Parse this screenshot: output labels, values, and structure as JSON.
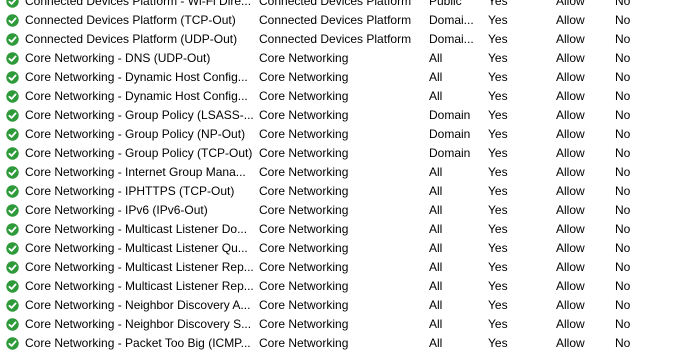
{
  "icons": {
    "enabled_rule": "check-circle-icon",
    "enabled_color": "#2e9a3a"
  },
  "rules": [
    {
      "name": "Connected Devices Platform - Wi-Fi Dire...",
      "group": "Connected Devices Platform",
      "profile": "Public",
      "enabled": "Yes",
      "action": "Allow",
      "override": "No"
    },
    {
      "name": "Connected Devices Platform (TCP-Out)",
      "group": "Connected Devices Platform",
      "profile": "Domai...",
      "enabled": "Yes",
      "action": "Allow",
      "override": "No"
    },
    {
      "name": "Connected Devices Platform (UDP-Out)",
      "group": "Connected Devices Platform",
      "profile": "Domai...",
      "enabled": "Yes",
      "action": "Allow",
      "override": "No"
    },
    {
      "name": "Core Networking - DNS (UDP-Out)",
      "group": "Core Networking",
      "profile": "All",
      "enabled": "Yes",
      "action": "Allow",
      "override": "No"
    },
    {
      "name": "Core Networking - Dynamic Host Config...",
      "group": "Core Networking",
      "profile": "All",
      "enabled": "Yes",
      "action": "Allow",
      "override": "No"
    },
    {
      "name": "Core Networking - Dynamic Host Config...",
      "group": "Core Networking",
      "profile": "All",
      "enabled": "Yes",
      "action": "Allow",
      "override": "No"
    },
    {
      "name": "Core Networking - Group Policy (LSASS-...",
      "group": "Core Networking",
      "profile": "Domain",
      "enabled": "Yes",
      "action": "Allow",
      "override": "No"
    },
    {
      "name": "Core Networking - Group Policy (NP-Out)",
      "group": "Core Networking",
      "profile": "Domain",
      "enabled": "Yes",
      "action": "Allow",
      "override": "No"
    },
    {
      "name": "Core Networking - Group Policy (TCP-Out)",
      "group": "Core Networking",
      "profile": "Domain",
      "enabled": "Yes",
      "action": "Allow",
      "override": "No"
    },
    {
      "name": "Core Networking - Internet Group Mana...",
      "group": "Core Networking",
      "profile": "All",
      "enabled": "Yes",
      "action": "Allow",
      "override": "No"
    },
    {
      "name": "Core Networking - IPHTTPS (TCP-Out)",
      "group": "Core Networking",
      "profile": "All",
      "enabled": "Yes",
      "action": "Allow",
      "override": "No"
    },
    {
      "name": "Core Networking - IPv6 (IPv6-Out)",
      "group": "Core Networking",
      "profile": "All",
      "enabled": "Yes",
      "action": "Allow",
      "override": "No"
    },
    {
      "name": "Core Networking - Multicast Listener Do...",
      "group": "Core Networking",
      "profile": "All",
      "enabled": "Yes",
      "action": "Allow",
      "override": "No"
    },
    {
      "name": "Core Networking - Multicast Listener Qu...",
      "group": "Core Networking",
      "profile": "All",
      "enabled": "Yes",
      "action": "Allow",
      "override": "No"
    },
    {
      "name": "Core Networking - Multicast Listener Rep...",
      "group": "Core Networking",
      "profile": "All",
      "enabled": "Yes",
      "action": "Allow",
      "override": "No"
    },
    {
      "name": "Core Networking - Multicast Listener Rep...",
      "group": "Core Networking",
      "profile": "All",
      "enabled": "Yes",
      "action": "Allow",
      "override": "No"
    },
    {
      "name": "Core Networking - Neighbor Discovery A...",
      "group": "Core Networking",
      "profile": "All",
      "enabled": "Yes",
      "action": "Allow",
      "override": "No"
    },
    {
      "name": "Core Networking - Neighbor Discovery S...",
      "group": "Core Networking",
      "profile": "All",
      "enabled": "Yes",
      "action": "Allow",
      "override": "No"
    },
    {
      "name": "Core Networking - Packet Too Big (ICMP...",
      "group": "Core Networking",
      "profile": "All",
      "enabled": "Yes",
      "action": "Allow",
      "override": "No"
    }
  ]
}
